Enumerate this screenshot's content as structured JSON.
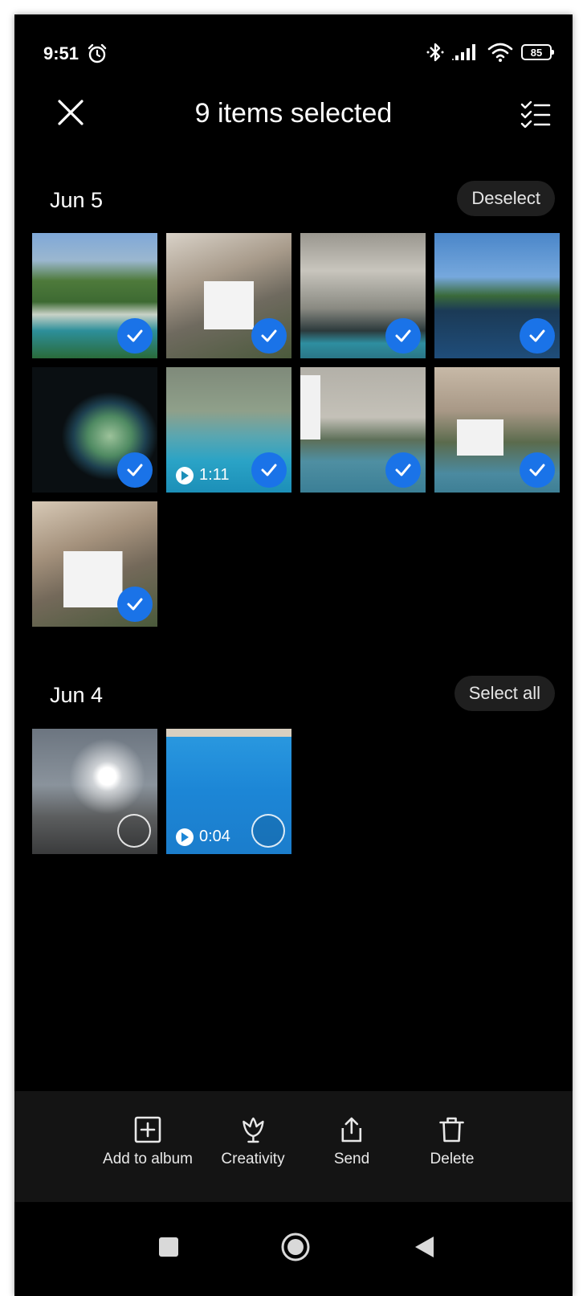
{
  "status_bar": {
    "time": "9:51",
    "battery": "85"
  },
  "header": {
    "title": "9 items selected"
  },
  "sections": [
    {
      "date": "Jun 5",
      "action": "Deselect",
      "items": [
        {
          "kind": "photo",
          "selected": true
        },
        {
          "kind": "photo",
          "selected": true
        },
        {
          "kind": "photo",
          "selected": true
        },
        {
          "kind": "photo",
          "selected": true
        },
        {
          "kind": "photo",
          "selected": true
        },
        {
          "kind": "video",
          "duration": "1:11",
          "selected": true
        },
        {
          "kind": "photo",
          "selected": true
        },
        {
          "kind": "photo",
          "selected": true
        },
        {
          "kind": "photo",
          "selected": true
        }
      ]
    },
    {
      "date": "Jun 4",
      "action": "Select all",
      "items": [
        {
          "kind": "photo",
          "selected": false
        },
        {
          "kind": "video",
          "duration": "0:04",
          "selected": false
        }
      ]
    }
  ],
  "toolbar": [
    {
      "label": "Add to album",
      "icon": "add-box-icon"
    },
    {
      "label": "Creativity",
      "icon": "tulip-icon"
    },
    {
      "label": "Send",
      "icon": "share-icon"
    },
    {
      "label": "Delete",
      "icon": "trash-icon"
    }
  ],
  "colors": {
    "accent": "#1a73e8",
    "background": "#000000",
    "toolbar": "#141414"
  }
}
